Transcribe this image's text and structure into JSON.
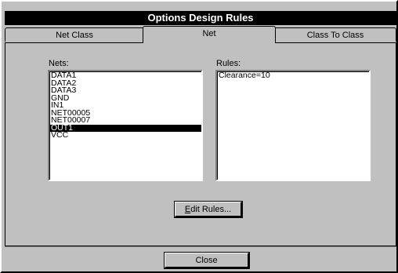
{
  "window": {
    "title": "Options Design Rules"
  },
  "tabs": [
    {
      "label": "Net Class",
      "active": false
    },
    {
      "label": "Net",
      "active": true
    },
    {
      "label": "Class To Class",
      "active": false
    }
  ],
  "nets": {
    "label": "Nets:",
    "items": [
      "DATA1",
      "DATA2",
      "DATA3",
      "GND",
      "IN1",
      "NET00005",
      "NET00007",
      "OUT1",
      "VCC"
    ],
    "selected": "OUT1"
  },
  "rules": {
    "label": "Rules:",
    "items": [
      "Clearance=10"
    ]
  },
  "buttons": {
    "edit_rules": {
      "mnemonic": "E",
      "rest": "dit Rules..."
    },
    "close": "Close"
  }
}
